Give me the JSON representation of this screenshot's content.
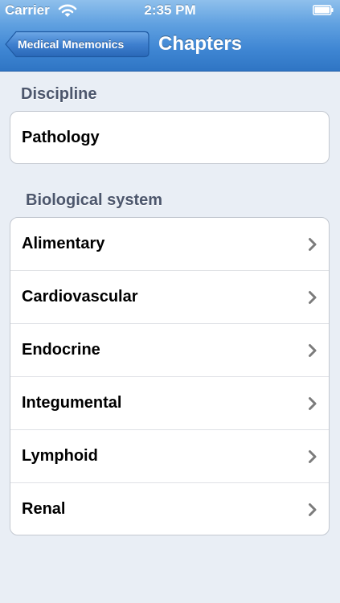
{
  "status_bar": {
    "carrier": "Carrier",
    "time": "2:35 PM"
  },
  "navbar": {
    "back_label": "Medical Mnemonics",
    "title": "Chapters"
  },
  "discipline": {
    "header": "Discipline",
    "item": "Pathology"
  },
  "biological_system": {
    "header": "Biological system",
    "items": [
      {
        "label": "Alimentary"
      },
      {
        "label": "Cardiovascular"
      },
      {
        "label": "Endocrine"
      },
      {
        "label": "Integumental"
      },
      {
        "label": "Lymphoid"
      },
      {
        "label": "Renal"
      }
    ]
  },
  "colors": {
    "nav_bar": "#3f86d3",
    "background": "#e9eef5",
    "section_header": "#4c566c",
    "chevron": "#7c7c7c"
  },
  "icons": {
    "wifi": "wifi-icon",
    "battery": "battery-icon",
    "chevron": "chevron-right-icon"
  }
}
